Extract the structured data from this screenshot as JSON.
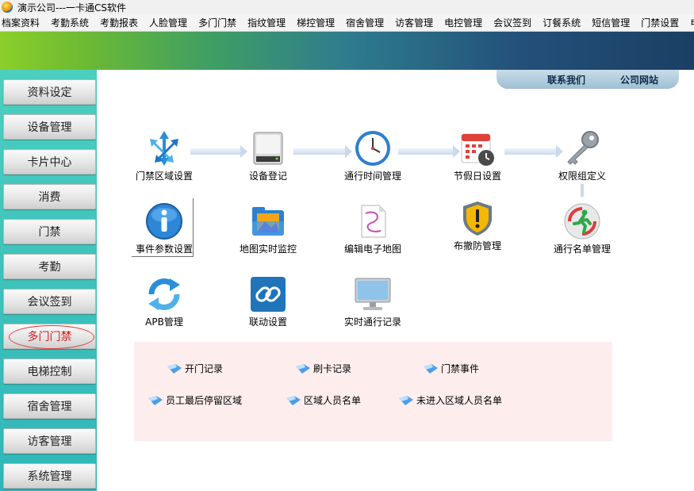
{
  "window": {
    "title": "演示公司---一卡通CS软件"
  },
  "menu": [
    "档案资料",
    "考勤系统",
    "考勤报表",
    "人脸管理",
    "多门门禁",
    "指纹管理",
    "梯控管理",
    "宿舍管理",
    "访客管理",
    "电控管理",
    "会议签到",
    "订餐系统",
    "短信管理",
    "门禁设置",
    "电"
  ],
  "top_links": {
    "contact": "联系我们",
    "website": "公司网站"
  },
  "sidebar": {
    "active_index": 7,
    "items": [
      "资料设定",
      "设备管理",
      "卡片中心",
      "消费",
      "门禁",
      "考勤",
      "会议签到",
      "多门门禁",
      "电梯控制",
      "宿舍管理",
      "访客管理",
      "系统管理"
    ]
  },
  "features": {
    "area": "门禁区域设置",
    "device": "设备登记",
    "timezone": "通行时间管理",
    "holiday": "节假日设置",
    "permission": "权限组定义",
    "event_params": "事件参数设置",
    "map_monitor": "地图实时监控",
    "edit_map": "编辑电子地图",
    "arming": "布撤防管理",
    "pass_list": "通行名单管理",
    "apb": "APB管理",
    "linkage": "联动设置",
    "live_records": "实时通行记录"
  },
  "reports": {
    "open_records": "开门记录",
    "card_records": "刷卡记录",
    "door_events": "门禁事件",
    "last_area": "员工最后停留区域",
    "area_people": "区域人员名单",
    "not_entered": "未进入区域人员名单"
  },
  "colors": {
    "active_nav": "#d21c1c",
    "panel_bg": "#fdeeed",
    "sidebar_bg": "#2fb6b8"
  }
}
